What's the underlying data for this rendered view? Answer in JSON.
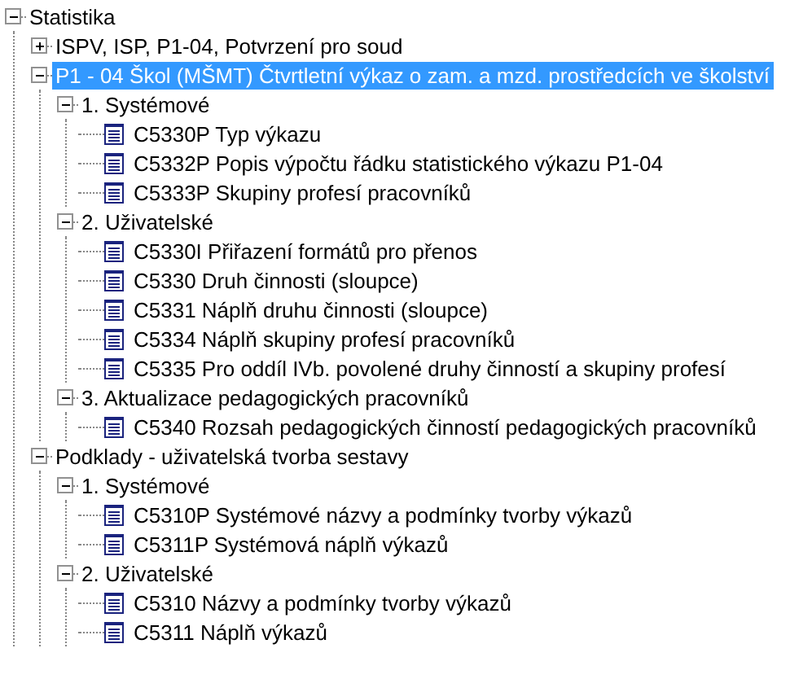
{
  "tree": [
    {
      "label": "Statistika",
      "kind": "folder",
      "expanded": true,
      "selected": false,
      "children": [
        {
          "label": "ISPV, ISP, P1-04, Potvrzení pro soud",
          "kind": "folder",
          "expanded": false,
          "selected": false
        },
        {
          "label": "P1 - 04 Škol (MŠMT) Čtvrtletní výkaz o zam. a mzd. prostředcích ve školství",
          "kind": "folder",
          "expanded": true,
          "selected": true,
          "children": [
            {
              "label": "1. Systémové",
              "kind": "folder",
              "expanded": true,
              "selected": false,
              "children": [
                {
                  "label": "C5330P Typ výkazu",
                  "kind": "report",
                  "selected": false
                },
                {
                  "label": "C5332P Popis výpočtu řádku statistického výkazu P1-04",
                  "kind": "report",
                  "selected": false
                },
                {
                  "label": "C5333P Skupiny profesí pracovníků",
                  "kind": "report",
                  "selected": false
                }
              ]
            },
            {
              "label": "2. Uživatelské",
              "kind": "folder",
              "expanded": true,
              "selected": false,
              "children": [
                {
                  "label": "C5330I Přiřazení formátů pro přenos",
                  "kind": "report",
                  "selected": false
                },
                {
                  "label": "C5330 Druh činnosti (sloupce)",
                  "kind": "report",
                  "selected": false
                },
                {
                  "label": "C5331 Náplň druhu činnosti (sloupce)",
                  "kind": "report",
                  "selected": false
                },
                {
                  "label": "C5334 Náplň skupiny profesí pracovníků",
                  "kind": "report",
                  "selected": false
                },
                {
                  "label": "C5335 Pro oddíl IVb. povolené druhy činností a skupiny profesí",
                  "kind": "report",
                  "selected": false
                }
              ]
            },
            {
              "label": "3. Aktualizace pedagogických pracovníků",
              "kind": "folder",
              "expanded": true,
              "selected": false,
              "children": [
                {
                  "label": "C5340 Rozsah pedagogických činností pedagogických pracovníků",
                  "kind": "report",
                  "selected": false
                }
              ]
            }
          ]
        },
        {
          "label": "Podklady - uživatelská tvorba sestavy",
          "kind": "folder",
          "expanded": true,
          "selected": false,
          "children": [
            {
              "label": "1. Systémové",
              "kind": "folder",
              "expanded": true,
              "selected": false,
              "children": [
                {
                  "label": "C5310P Systémové názvy a podmínky tvorby výkazů",
                  "kind": "report",
                  "selected": false
                },
                {
                  "label": "C5311P Systémová náplň výkazů",
                  "kind": "report",
                  "selected": false
                }
              ]
            },
            {
              "label": "2. Uživatelské",
              "kind": "folder",
              "expanded": true,
              "selected": false,
              "children": [
                {
                  "label": "C5310 Názvy a podmínky tvorby výkazů",
                  "kind": "report",
                  "selected": false
                },
                {
                  "label": "C5311 Náplň výkazů",
                  "kind": "report",
                  "selected": false
                }
              ]
            }
          ]
        }
      ]
    }
  ]
}
